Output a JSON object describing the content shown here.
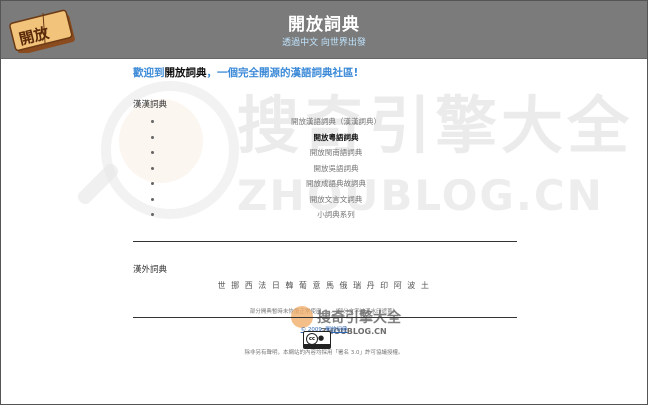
{
  "header": {
    "logo_text": "開放",
    "title": "開放詞典",
    "subtitle": "透過中文 向世界出發"
  },
  "welcome": {
    "prefix": "歡迎到",
    "site": "開放詞典",
    "suffix": "，一個完全開源的漢語詞典社區!"
  },
  "han_section": {
    "heading": "漢漢詞典",
    "items": [
      {
        "label": "開放漢語詞典（漢漢詞典）",
        "active": false
      },
      {
        "label": "開放粵語詞典",
        "active": true
      },
      {
        "label": "開放閩南語詞典",
        "active": false
      },
      {
        "label": "開放吳語詞典",
        "active": false
      },
      {
        "label": "開放成語典故詞典",
        "active": false
      },
      {
        "label": "開放文言文詞典",
        "active": false
      },
      {
        "label": "小詞典系列",
        "active": false
      }
    ]
  },
  "foreign_section": {
    "heading": "漢外詞典",
    "languages": "世 挪 西 法 日 韓 葡 意 馬 俄 瑞 丹 印 阿 波 土"
  },
  "footer": {
    "note1": "部分開典暫時未恢復正常使用，...（部分文字被浮水印遮蓋）",
    "copyright": "© 2009. 開放詞典",
    "cc_text": "cc",
    "note2": "除非另有聲明，本網站的內容均採用「署名 3.0」許可協議授權。"
  },
  "watermark": {
    "brand": "搜奇引擎大全",
    "domain": "ZHOUBLOG.CN",
    "small_brand": "搜奇引擎大全",
    "small_domain": "ZHOUBLOG.CN"
  },
  "colors": {
    "header_bg": "#7b7b7b",
    "accent_blue": "#3d8bd8",
    "subtitle_blue": "#bfe4ff"
  }
}
